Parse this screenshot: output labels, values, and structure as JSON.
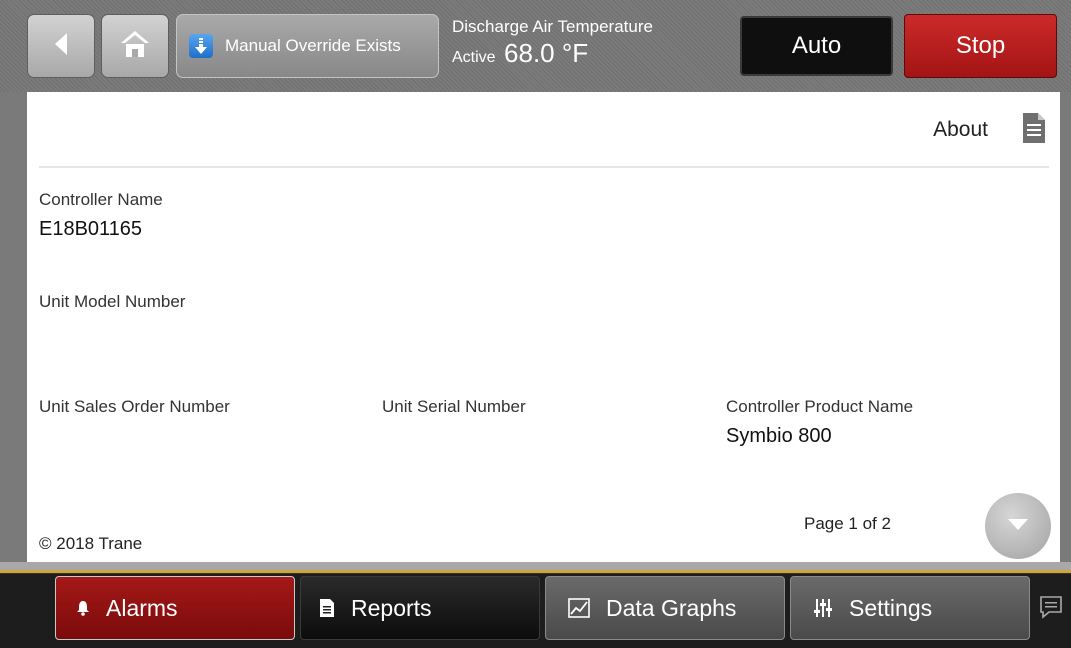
{
  "header": {
    "override_label": "Manual Override Exists",
    "point_name": "Discharge Air Temperature",
    "point_status": "Active",
    "point_value": "68.0 °F",
    "auto_label": "Auto",
    "stop_label": "Stop"
  },
  "page": {
    "title": "About",
    "fields": {
      "controller_name_label": "Controller Name",
      "controller_name_value": "E18B01165",
      "unit_model_label": "Unit Model Number",
      "sales_order_label": "Unit Sales Order Number",
      "serial_label": "Unit Serial Number",
      "product_name_label": "Controller Product Name",
      "product_name_value": "Symbio 800"
    },
    "copyright": "© 2018 Trane",
    "page_indicator": "Page 1 of 2"
  },
  "footer": {
    "tabs": [
      {
        "label": "Alarms",
        "icon": "bell-icon"
      },
      {
        "label": "Reports",
        "icon": "document-icon"
      },
      {
        "label": "Data Graphs",
        "icon": "line-chart-icon"
      },
      {
        "label": "Settings",
        "icon": "sliders-icon"
      }
    ]
  },
  "colors": {
    "stop": "#b81c1c",
    "alarms": "#8e1010",
    "accent_line": "#d0a43a",
    "override_icon": "#2f86e0"
  }
}
